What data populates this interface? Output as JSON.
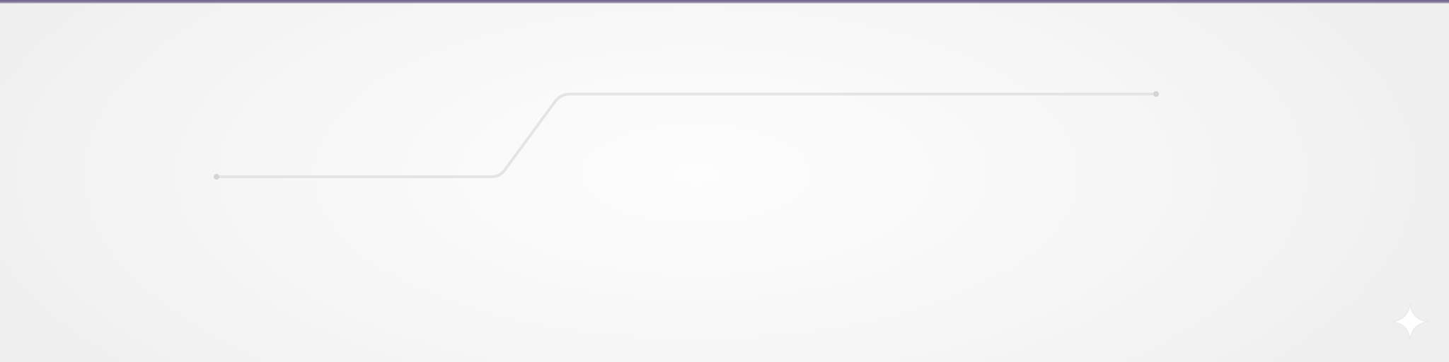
{
  "colors": {
    "accent_bar": "#6f6189",
    "connector_line": "#e4e4e4",
    "endpoint_dot": "#d4d4d4",
    "sparkle": "#ffffff"
  },
  "icons": {
    "watermark": "sparkle-icon"
  }
}
